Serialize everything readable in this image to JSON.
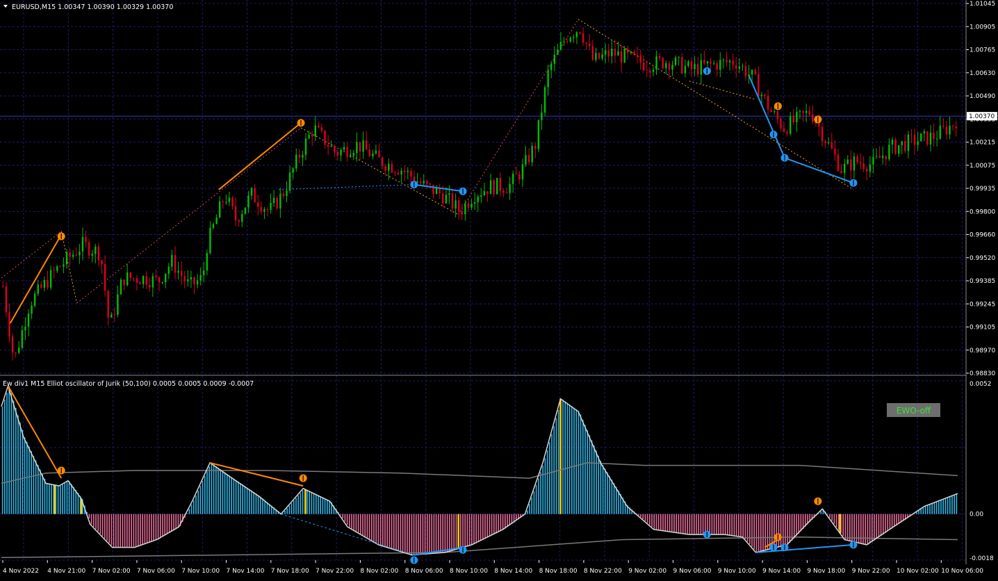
{
  "symbol_header": "EURUSD,M15  1.00347 1.00390 1.00329 1.00370",
  "indicator_header": "Ew div1  M15 Elliot oscillator of Jurik (50,100) 0.0005 0.0005 0.0009 -0.0007",
  "ewo_button": "EWO-off",
  "colors": {
    "background": "#000000",
    "grid": "#1c1c6e",
    "bull_candle": "#00c000",
    "bear_candle": "#e0001e",
    "divergence_bear": "#ff8a00",
    "divergence_bull": "#2196f3",
    "zigzag_bear": "#f5a623",
    "zigzag_bull": "#d84a4a",
    "histogram_pos": "#33b7e8",
    "histogram_neg": "#e86f9a",
    "signal_line": "#7a7a7a",
    "current_price_line": "#2e3cb0",
    "axis_text": "#ffffff",
    "button_bg": "#6e6e6e",
    "button_text": "#3ce23c"
  },
  "chart_data": [
    {
      "type": "candlestick",
      "title": "EURUSD,M15  1.00347 1.00390 1.00329 1.00370",
      "current_price": "1.00370",
      "y_ticks": [
        "1.01045",
        "1.00905",
        "1.00765",
        "1.00630",
        "1.00490",
        "1.00355",
        "1.00215",
        "1.00075",
        "0.99935",
        "0.99800",
        "0.99660",
        "0.99520",
        "0.99385",
        "0.99245",
        "0.99105",
        "0.98970",
        "0.98830"
      ],
      "ylim": [
        0.9883,
        1.01045
      ],
      "close_path": [
        {
          "x": 0.0,
          "y": 0.9935
        },
        {
          "x": 0.5,
          "y": 0.989
        },
        {
          "x": 1.2,
          "y": 0.9925
        },
        {
          "x": 2.4,
          "y": 0.9945
        },
        {
          "x": 3.6,
          "y": 0.996
        },
        {
          "x": 4.4,
          "y": 0.9955
        },
        {
          "x": 4.8,
          "y": 0.991
        },
        {
          "x": 5.4,
          "y": 0.994
        },
        {
          "x": 6.4,
          "y": 0.994
        },
        {
          "x": 7.0,
          "y": 0.9938
        },
        {
          "x": 7.6,
          "y": 0.995
        },
        {
          "x": 8.4,
          "y": 0.9935
        },
        {
          "x": 9.0,
          "y": 0.994
        },
        {
          "x": 9.2,
          "y": 0.996
        },
        {
          "x": 10.0,
          "y": 0.999
        },
        {
          "x": 10.5,
          "y": 0.9975
        },
        {
          "x": 11.2,
          "y": 0.999
        },
        {
          "x": 12.0,
          "y": 0.998
        },
        {
          "x": 12.6,
          "y": 0.999
        },
        {
          "x": 13.4,
          "y": 1.0015
        },
        {
          "x": 14.0,
          "y": 1.003
        },
        {
          "x": 15.0,
          "y": 1.0015
        },
        {
          "x": 16.0,
          "y": 1.002
        },
        {
          "x": 17.0,
          "y": 1.001
        },
        {
          "x": 18.0,
          "y": 1.0005
        },
        {
          "x": 19.0,
          "y": 0.9995
        },
        {
          "x": 19.8,
          "y": 0.999
        },
        {
          "x": 20.6,
          "y": 0.998
        },
        {
          "x": 21.2,
          "y": 0.999
        },
        {
          "x": 22.0,
          "y": 0.9995
        },
        {
          "x": 22.8,
          "y": 0.9995
        },
        {
          "x": 23.4,
          "y": 1.0005
        },
        {
          "x": 24.0,
          "y": 1.002
        },
        {
          "x": 24.6,
          "y": 1.0065
        },
        {
          "x": 25.4,
          "y": 1.0085
        },
        {
          "x": 26.0,
          "y": 1.009
        },
        {
          "x": 26.6,
          "y": 1.007
        },
        {
          "x": 27.4,
          "y": 1.0075
        },
        {
          "x": 28.2,
          "y": 1.0072
        },
        {
          "x": 29.0,
          "y": 1.0068
        },
        {
          "x": 30.0,
          "y": 1.007
        },
        {
          "x": 31.0,
          "y": 1.0065
        },
        {
          "x": 32.0,
          "y": 1.0068
        },
        {
          "x": 33.0,
          "y": 1.007
        },
        {
          "x": 33.8,
          "y": 1.006
        },
        {
          "x": 34.6,
          "y": 1.004
        },
        {
          "x": 35.2,
          "y": 1.003
        },
        {
          "x": 35.8,
          "y": 1.0035
        },
        {
          "x": 36.4,
          "y": 1.004
        },
        {
          "x": 37.2,
          "y": 1.002
        },
        {
          "x": 37.8,
          "y": 1.0005
        },
        {
          "x": 38.4,
          "y": 1.001
        },
        {
          "x": 39.2,
          "y": 1.0008
        },
        {
          "x": 40.0,
          "y": 1.0018
        },
        {
          "x": 41.0,
          "y": 1.0022
        },
        {
          "x": 42.0,
          "y": 1.0025
        },
        {
          "x": 42.8,
          "y": 1.0032
        },
        {
          "x": 43.1,
          "y": 1.0037
        }
      ]
    },
    {
      "type": "histogram",
      "title": "Ew div1  M15 Elliot oscillator of Jurik (50,100) 0.0005 0.0005 0.0009 -0.0007",
      "y_ticks": [
        "0.0052",
        "0.00",
        "-0.0018"
      ],
      "ylim": [
        -0.0018,
        0.0052
      ],
      "oscillator_path": [
        {
          "x": 0.0,
          "y": 0.0042
        },
        {
          "x": 0.3,
          "y": 0.005
        },
        {
          "x": 1.0,
          "y": 0.003
        },
        {
          "x": 2.0,
          "y": 0.0012
        },
        {
          "x": 2.6,
          "y": 0.0011
        },
        {
          "x": 3.0,
          "y": 0.0013
        },
        {
          "x": 3.6,
          "y": 0.0006
        },
        {
          "x": 4.0,
          "y": -0.0004
        },
        {
          "x": 5.0,
          "y": -0.0013
        },
        {
          "x": 6.0,
          "y": -0.0013
        },
        {
          "x": 7.0,
          "y": -0.001
        },
        {
          "x": 8.0,
          "y": -0.0005
        },
        {
          "x": 8.6,
          "y": 0.0005
        },
        {
          "x": 9.4,
          "y": 0.002
        },
        {
          "x": 10.4,
          "y": 0.0014
        },
        {
          "x": 11.6,
          "y": 0.0007
        },
        {
          "x": 12.6,
          "y": 0.0
        },
        {
          "x": 13.6,
          "y": 0.001
        },
        {
          "x": 14.8,
          "y": 0.0005
        },
        {
          "x": 15.6,
          "y": -0.0005
        },
        {
          "x": 17.0,
          "y": -0.0012
        },
        {
          "x": 18.5,
          "y": -0.0016
        },
        {
          "x": 20.0,
          "y": -0.0015
        },
        {
          "x": 21.2,
          "y": -0.0012
        },
        {
          "x": 22.6,
          "y": -0.0006
        },
        {
          "x": 23.6,
          "y": 0.0
        },
        {
          "x": 24.4,
          "y": 0.002
        },
        {
          "x": 25.2,
          "y": 0.0045
        },
        {
          "x": 26.0,
          "y": 0.004
        },
        {
          "x": 27.0,
          "y": 0.002
        },
        {
          "x": 28.2,
          "y": 0.0003
        },
        {
          "x": 29.4,
          "y": -0.0006
        },
        {
          "x": 31.0,
          "y": -0.0008
        },
        {
          "x": 32.6,
          "y": -0.0008
        },
        {
          "x": 33.4,
          "y": -0.0009
        },
        {
          "x": 34.0,
          "y": -0.0015
        },
        {
          "x": 35.4,
          "y": -0.0012
        },
        {
          "x": 36.4,
          "y": -0.0003
        },
        {
          "x": 37.0,
          "y": 0.0002
        },
        {
          "x": 38.0,
          "y": -0.001
        },
        {
          "x": 39.0,
          "y": -0.0012
        },
        {
          "x": 40.2,
          "y": -0.0005
        },
        {
          "x": 41.6,
          "y": 0.0003
        },
        {
          "x": 43.1,
          "y": 0.0008
        }
      ],
      "signal_path": [
        {
          "x": 0.0,
          "y": 0.0012
        },
        {
          "x": 2.0,
          "y": 0.0016
        },
        {
          "x": 6.0,
          "y": 0.0017
        },
        {
          "x": 12.0,
          "y": 0.0017
        },
        {
          "x": 18.0,
          "y": 0.0016
        },
        {
          "x": 23.8,
          "y": 0.0014
        },
        {
          "x": 26.4,
          "y": 0.002
        },
        {
          "x": 29.0,
          "y": 0.0019
        },
        {
          "x": 36.0,
          "y": 0.0019
        },
        {
          "x": 43.1,
          "y": 0.0015
        }
      ],
      "signal_path_2": [
        {
          "x": 0.0,
          "y": -0.0017
        },
        {
          "x": 10.0,
          "y": -0.0016
        },
        {
          "x": 20.0,
          "y": -0.0015
        },
        {
          "x": 28.0,
          "y": -0.001
        },
        {
          "x": 36.0,
          "y": -0.0009
        },
        {
          "x": 43.1,
          "y": -0.001
        }
      ],
      "signal_bars": [
        {
          "x": 2.4,
          "color": "yellow"
        },
        {
          "x": 3.6,
          "color": "yellow"
        },
        {
          "x": 13.7,
          "color": "yellow"
        },
        {
          "x": 20.6,
          "color": "yellow"
        },
        {
          "x": 25.2,
          "color": "yellow"
        },
        {
          "x": 37.8,
          "color": "yellow"
        }
      ]
    }
  ],
  "x_axis_labels": [
    "4 Nov 2022",
    "4 Nov 21:00",
    "7 Nov 02:00",
    "7 Nov 06:00",
    "7 Nov 10:00",
    "7 Nov 14:00",
    "7 Nov 18:00",
    "7 Nov 22:00",
    "8 Nov 02:00",
    "8 Nov 06:00",
    "8 Nov 10:00",
    "8 Nov 14:00",
    "8 Nov 18:00",
    "8 Nov 22:00",
    "9 Nov 02:00",
    "9 Nov 06:00",
    "9 Nov 10:00",
    "9 Nov 14:00",
    "9 Nov 18:00",
    "9 Nov 22:00",
    "10 Nov 02:00",
    "10 Nov 06:00"
  ],
  "divergence_markers": [
    {
      "pane": 0,
      "x": 2.7,
      "y": 0.9965,
      "dir": "down",
      "color": "divergence_bear"
    },
    {
      "pane": 0,
      "x": 13.5,
      "y": 1.0033,
      "dir": "down",
      "color": "divergence_bear"
    },
    {
      "pane": 0,
      "x": 18.6,
      "y": 0.9996,
      "dir": "up",
      "color": "divergence_bull"
    },
    {
      "pane": 0,
      "x": 20.8,
      "y": 0.9992,
      "dir": "up",
      "color": "divergence_bull"
    },
    {
      "pane": 0,
      "x": 31.8,
      "y": 1.0064,
      "dir": "up",
      "color": "divergence_bull"
    },
    {
      "pane": 0,
      "x": 34.8,
      "y": 1.0026,
      "dir": "up",
      "color": "divergence_bull"
    },
    {
      "pane": 0,
      "x": 35.0,
      "y": 1.0043,
      "dir": "down",
      "color": "divergence_bear"
    },
    {
      "pane": 0,
      "x": 35.3,
      "y": 1.0012,
      "dir": "up",
      "color": "divergence_bull"
    },
    {
      "pane": 0,
      "x": 36.8,
      "y": 1.0035,
      "dir": "down",
      "color": "divergence_bear"
    },
    {
      "pane": 0,
      "x": 38.4,
      "y": 0.9997,
      "dir": "up",
      "color": "divergence_bull"
    },
    {
      "pane": 1,
      "x": 2.7,
      "y": 0.0017,
      "dir": "down",
      "color": "divergence_bear"
    },
    {
      "pane": 1,
      "x": 13.6,
      "y": 0.0014,
      "dir": "down",
      "color": "divergence_bear"
    },
    {
      "pane": 1,
      "x": 18.6,
      "y": -0.0018,
      "dir": "up",
      "color": "divergence_bull"
    },
    {
      "pane": 1,
      "x": 20.8,
      "y": -0.0014,
      "dir": "up",
      "color": "divergence_bull"
    },
    {
      "pane": 1,
      "x": 31.8,
      "y": -0.0008,
      "dir": "up",
      "color": "divergence_bull"
    },
    {
      "pane": 1,
      "x": 34.8,
      "y": -0.0013,
      "dir": "up",
      "color": "divergence_bull"
    },
    {
      "pane": 1,
      "x": 35.0,
      "y": -0.0009,
      "dir": "down",
      "color": "divergence_bear"
    },
    {
      "pane": 1,
      "x": 35.3,
      "y": -0.0013,
      "dir": "up",
      "color": "divergence_bull"
    },
    {
      "pane": 1,
      "x": 36.8,
      "y": 0.0005,
      "dir": "down",
      "color": "divergence_bear"
    },
    {
      "pane": 1,
      "x": 38.4,
      "y": -0.0012,
      "dir": "up",
      "color": "divergence_bull"
    }
  ]
}
